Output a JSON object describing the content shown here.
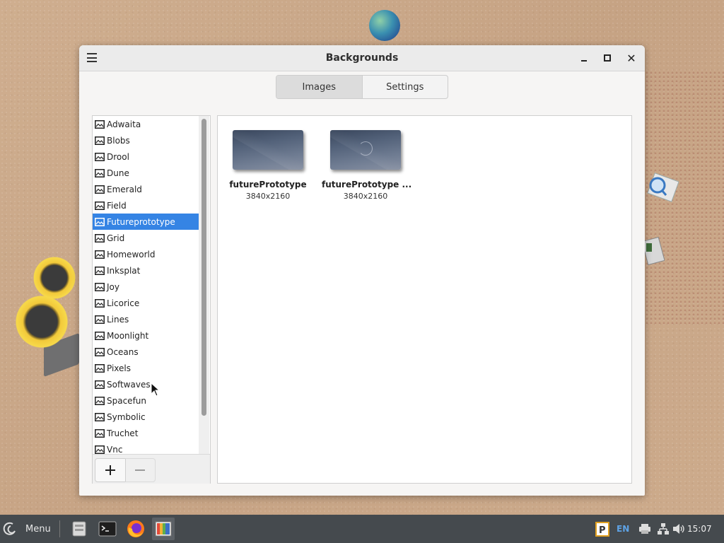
{
  "window": {
    "title": "Backgrounds",
    "tabs": [
      {
        "label": "Images",
        "active": true
      },
      {
        "label": "Settings",
        "active": false
      }
    ]
  },
  "sidebar": {
    "selected": "Futureprototype",
    "items": [
      {
        "label": "Adwaita",
        "icon": "image-icon"
      },
      {
        "label": "Blobs",
        "icon": "image-icon"
      },
      {
        "label": "Drool",
        "icon": "image-icon"
      },
      {
        "label": "Dune",
        "icon": "image-icon"
      },
      {
        "label": "Emerald",
        "icon": "image-icon"
      },
      {
        "label": "Field",
        "icon": "image-icon"
      },
      {
        "label": "Futureprototype",
        "icon": "image-icon"
      },
      {
        "label": "Grid",
        "icon": "image-icon"
      },
      {
        "label": "Homeworld",
        "icon": "image-icon"
      },
      {
        "label": "Inksplat",
        "icon": "image-icon"
      },
      {
        "label": "Joy",
        "icon": "image-icon"
      },
      {
        "label": "Licorice",
        "icon": "image-icon"
      },
      {
        "label": "Lines",
        "icon": "image-icon"
      },
      {
        "label": "Moonlight",
        "icon": "image-icon"
      },
      {
        "label": "Oceans",
        "icon": "image-icon"
      },
      {
        "label": "Pixels",
        "icon": "image-icon"
      },
      {
        "label": "Softwaves",
        "icon": "image-icon"
      },
      {
        "label": "Spacefun",
        "icon": "image-icon"
      },
      {
        "label": "Symbolic",
        "icon": "image-icon"
      },
      {
        "label": "Truchet",
        "icon": "image-icon"
      },
      {
        "label": "Vnc",
        "icon": "image-icon"
      }
    ],
    "toolbar": {
      "add_icon": "plus-icon",
      "remove_icon": "minus-icon"
    }
  },
  "thumbnails": [
    {
      "name": "futurePrototype",
      "size": "3840x2160"
    },
    {
      "name": "futurePrototype ...",
      "size": "3840x2160"
    }
  ],
  "taskbar": {
    "menu_label": "Menu",
    "launchers": [
      "file-manager-icon",
      "terminal-icon",
      "firefox-icon",
      "backgrounds-app-icon"
    ],
    "tray": {
      "language": "EN",
      "clock": "15:07"
    }
  },
  "colors": {
    "accent": "#3584e4",
    "taskbar": "#454a4e"
  }
}
